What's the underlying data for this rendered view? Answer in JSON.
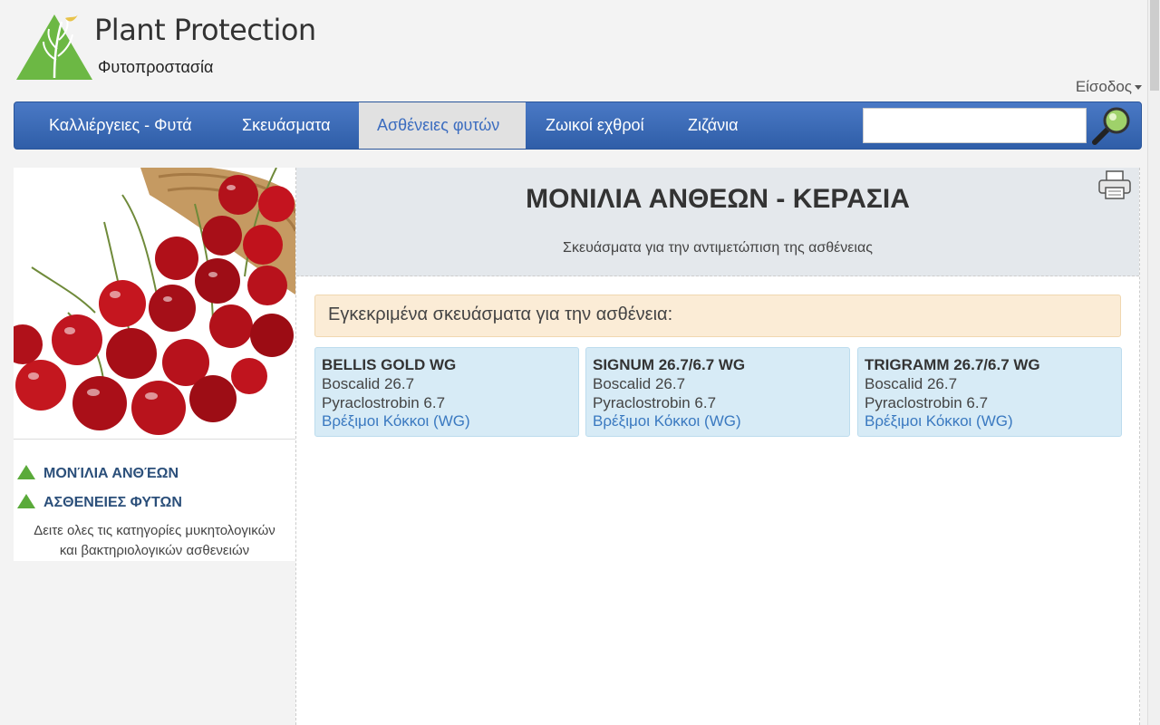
{
  "header": {
    "title": "Plant Protection",
    "subtitle": "Φυτοπροστασία",
    "login_label": "Είσοδος"
  },
  "nav": {
    "items": [
      {
        "label": "Καλλιέργειες - Φυτά"
      },
      {
        "label": "Σκευάσματα"
      },
      {
        "label": "Ασθένειες φυτών"
      },
      {
        "label": "Ζωικοί εχθροί"
      },
      {
        "label": "Ζιζάνια"
      }
    ],
    "active_index": 2,
    "search_value": ""
  },
  "sidebar": {
    "links": [
      {
        "label": "ΜΟΝΊΛΙΑ ΑΝΘΈΩΝ"
      },
      {
        "label": "ΑΣΘΕΝΕΙΕΣ ΦΥΤΩΝ"
      }
    ],
    "description_line1": "Δειτε ολες τις κατηγορίες μυκητολογικών",
    "description_line2": "και βακτηριολογικών ασθενειών"
  },
  "content": {
    "title": "ΜΟΝΙΛΙΑ ΑΝΘΕΩΝ - ΚΕΡΑΣΙΑ",
    "subtitle": "Σκευάσματα για την αντιμετώπιση της ασθένειας",
    "approved_heading": "Εγκεκριμένα σκευάσματα για την ασθένεια:",
    "products": [
      {
        "name": "BELLIS GOLD WG",
        "ingredient1": "Boscalid 26.7",
        "ingredient2": "Pyraclostrobin 6.7",
        "formulation": "Βρέξιμοι Κόκκοι (WG)"
      },
      {
        "name": "SIGNUM 26.7/6.7 WG",
        "ingredient1": "Boscalid 26.7",
        "ingredient2": "Pyraclostrobin 6.7",
        "formulation": "Βρέξιμοι Κόκκοι (WG)"
      },
      {
        "name": "TRIGRAMM 26.7/6.7 WG",
        "ingredient1": "Boscalid 26.7",
        "ingredient2": "Pyraclostrobin 6.7",
        "formulation": "Βρέξιμοι Κόκκοι (WG)"
      }
    ]
  },
  "colors": {
    "navbar": "#3a68b6",
    "nav_active_bg": "#e1e1e1",
    "approved_bg": "#fbecd6",
    "card_bg": "#d7ebf6",
    "accent_green": "#5aaa3a"
  }
}
